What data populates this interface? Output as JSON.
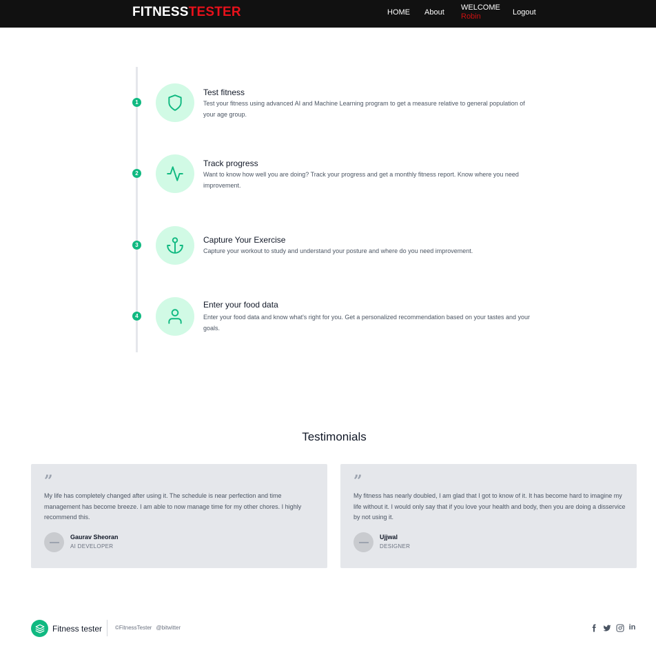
{
  "navbar": {
    "brand_part1": "FITNESS",
    "brand_part2": "TESTER",
    "links": [
      "HOME",
      "About"
    ],
    "welcome_label": "WELCOME",
    "user_name": "Robin",
    "logout_label": "Logout"
  },
  "steps": [
    {
      "number": "1",
      "icon": "shield-icon",
      "title": "Test fitness",
      "description": "Test your fitness using advanced AI and Machine Learning program to get a measure relative to general population of your age group."
    },
    {
      "number": "2",
      "icon": "activity-icon",
      "title": "Track progress",
      "description": "Want to know how well you are doing? Track your progress and get a monthly fitness report. Know where you need improvement."
    },
    {
      "number": "3",
      "icon": "anchor-icon",
      "title": "Capture Your Exercise",
      "description": "Capture your workout to study and understand your posture and where do you need improvement."
    },
    {
      "number": "4",
      "icon": "user-icon",
      "title": "Enter your food data",
      "description": "Enter your food data and know what's right for you. Get a personalized recommendation based on your tastes and your goals."
    }
  ],
  "testimonials": {
    "title": "Testimonials",
    "items": [
      {
        "text": "My life has completely changed after using it. The schedule is near perfection and time management has become breeze. I am able to now manage time for my other chores. I highly recommend this.",
        "name": "Gaurav Sheoran",
        "role": "AI DEVELOPER"
      },
      {
        "text": "My fitness has nearly doubled, I am glad that I got to know of it. It has become hard to imagine my life without it. I would only say that if you love your health and body, then you are doing a disservice by not using it.",
        "name": "Ujjwal",
        "role": "DESIGNER"
      }
    ]
  },
  "footer": {
    "name": "Fitness tester",
    "copyright": "©FitnessTester",
    "handle": "@bitwitter",
    "social_icons": [
      "facebook-icon",
      "twitter-icon",
      "instagram-icon",
      "linkedin-icon"
    ],
    "linkedin_text": "in"
  },
  "colors": {
    "accent": "#10b981",
    "accent_light": "#d1fae5",
    "brand_red": "#e8111b",
    "navbar_bg": "#111111",
    "card_bg": "#e5e7eb"
  }
}
